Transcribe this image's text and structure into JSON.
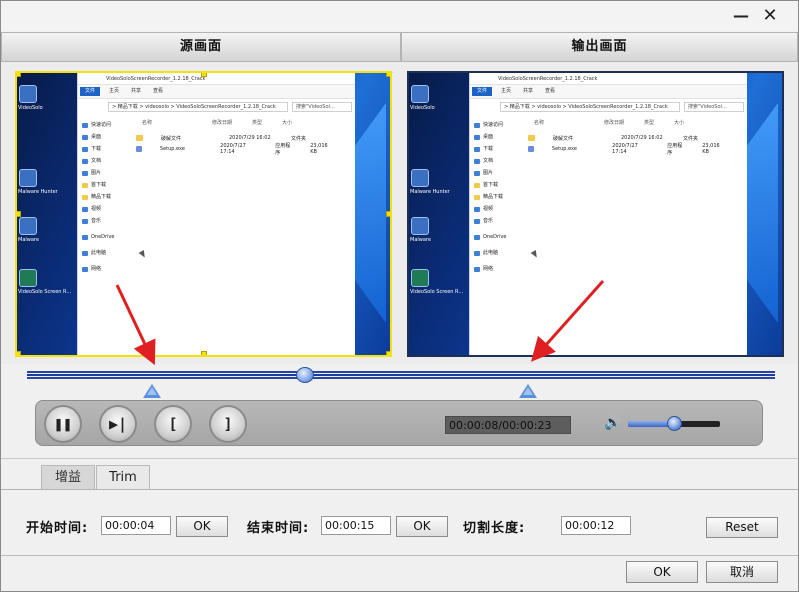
{
  "window": {
    "minimize_glyph": "—",
    "close_glyph": "✕"
  },
  "preview": {
    "source_title": "源画面",
    "output_title": "输出画面",
    "desktop_icons": [
      "VideoSolo",
      "Malware Hunter",
      "Malware",
      "VideoSolo Screen R..."
    ],
    "explorer": {
      "title": "VideoSoloScreenRecorder_1.2.18_Crack",
      "tabs": [
        "文件",
        "主页",
        "共享",
        "查看"
      ],
      "address": "> 精品下载 > videosolo > VideoSoloScreenRecorder_1.2.18_Crack",
      "search": "搜索\"VideoSol...",
      "nav_items": [
        "快速访问",
        "桌面",
        "下载",
        "文档",
        "图片",
        "首下载",
        "精品下载",
        "视频",
        "音乐",
        "OneDrive",
        "此电脑",
        "网络"
      ],
      "columns": [
        "名称",
        "修改日期",
        "类型",
        "大小"
      ],
      "files": [
        {
          "name": "破解文件",
          "date": "2020/7/29 16:02",
          "type": "文件夹",
          "size": ""
        },
        {
          "name": "Setup.exe",
          "date": "2020/7/27 17:14",
          "type": "应用程序",
          "size": "23,016 KB"
        }
      ]
    }
  },
  "controls": {
    "pause_glyph": "❚❚",
    "step_glyph": "▶|",
    "mark_in_glyph": "[",
    "mark_out_glyph": "]",
    "time_display": "00:00:08/00:00:23",
    "volume_icon": "🔊",
    "timeline_progress": 0.372,
    "volume_level": 0.5
  },
  "tabs": {
    "gain_label": "增益",
    "trim_label": "Trim"
  },
  "trim": {
    "start_label": "开始时间:",
    "start_value": "00:00:04",
    "start_ok": "OK",
    "end_label": "结束时间:",
    "end_value": "00:00:15",
    "end_ok": "OK",
    "length_label": "切割长度:",
    "length_value": "00:00:12",
    "reset_label": "Reset"
  },
  "footer": {
    "ok_label": "OK",
    "cancel_label": "取消"
  },
  "colors": {
    "accent": "#2744a8",
    "selection_border": "#f2e20a",
    "arrow": "#e02020"
  }
}
